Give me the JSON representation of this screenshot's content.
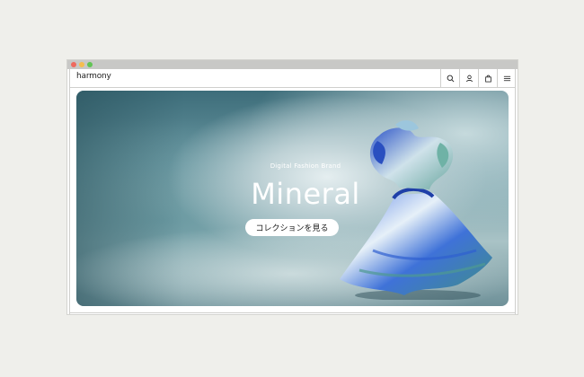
{
  "window": {
    "controls": [
      "close",
      "minimize",
      "maximize"
    ]
  },
  "header": {
    "logo": "harmony",
    "icons": [
      "search-icon",
      "user-icon",
      "shopping-bag-icon",
      "menu-icon"
    ]
  },
  "hero": {
    "tagline": "Digital Fashion Brand",
    "title": "Mineral",
    "cta_label": "コレクションを見る"
  },
  "colors": {
    "page_bg": "#efefeb",
    "titlebar": "#c8c8c6",
    "hero_dark": "#3d6d7a",
    "hero_light": "#e5eef0",
    "dress_blue": "#2f5fd0",
    "dress_teal": "#4e9a92"
  }
}
